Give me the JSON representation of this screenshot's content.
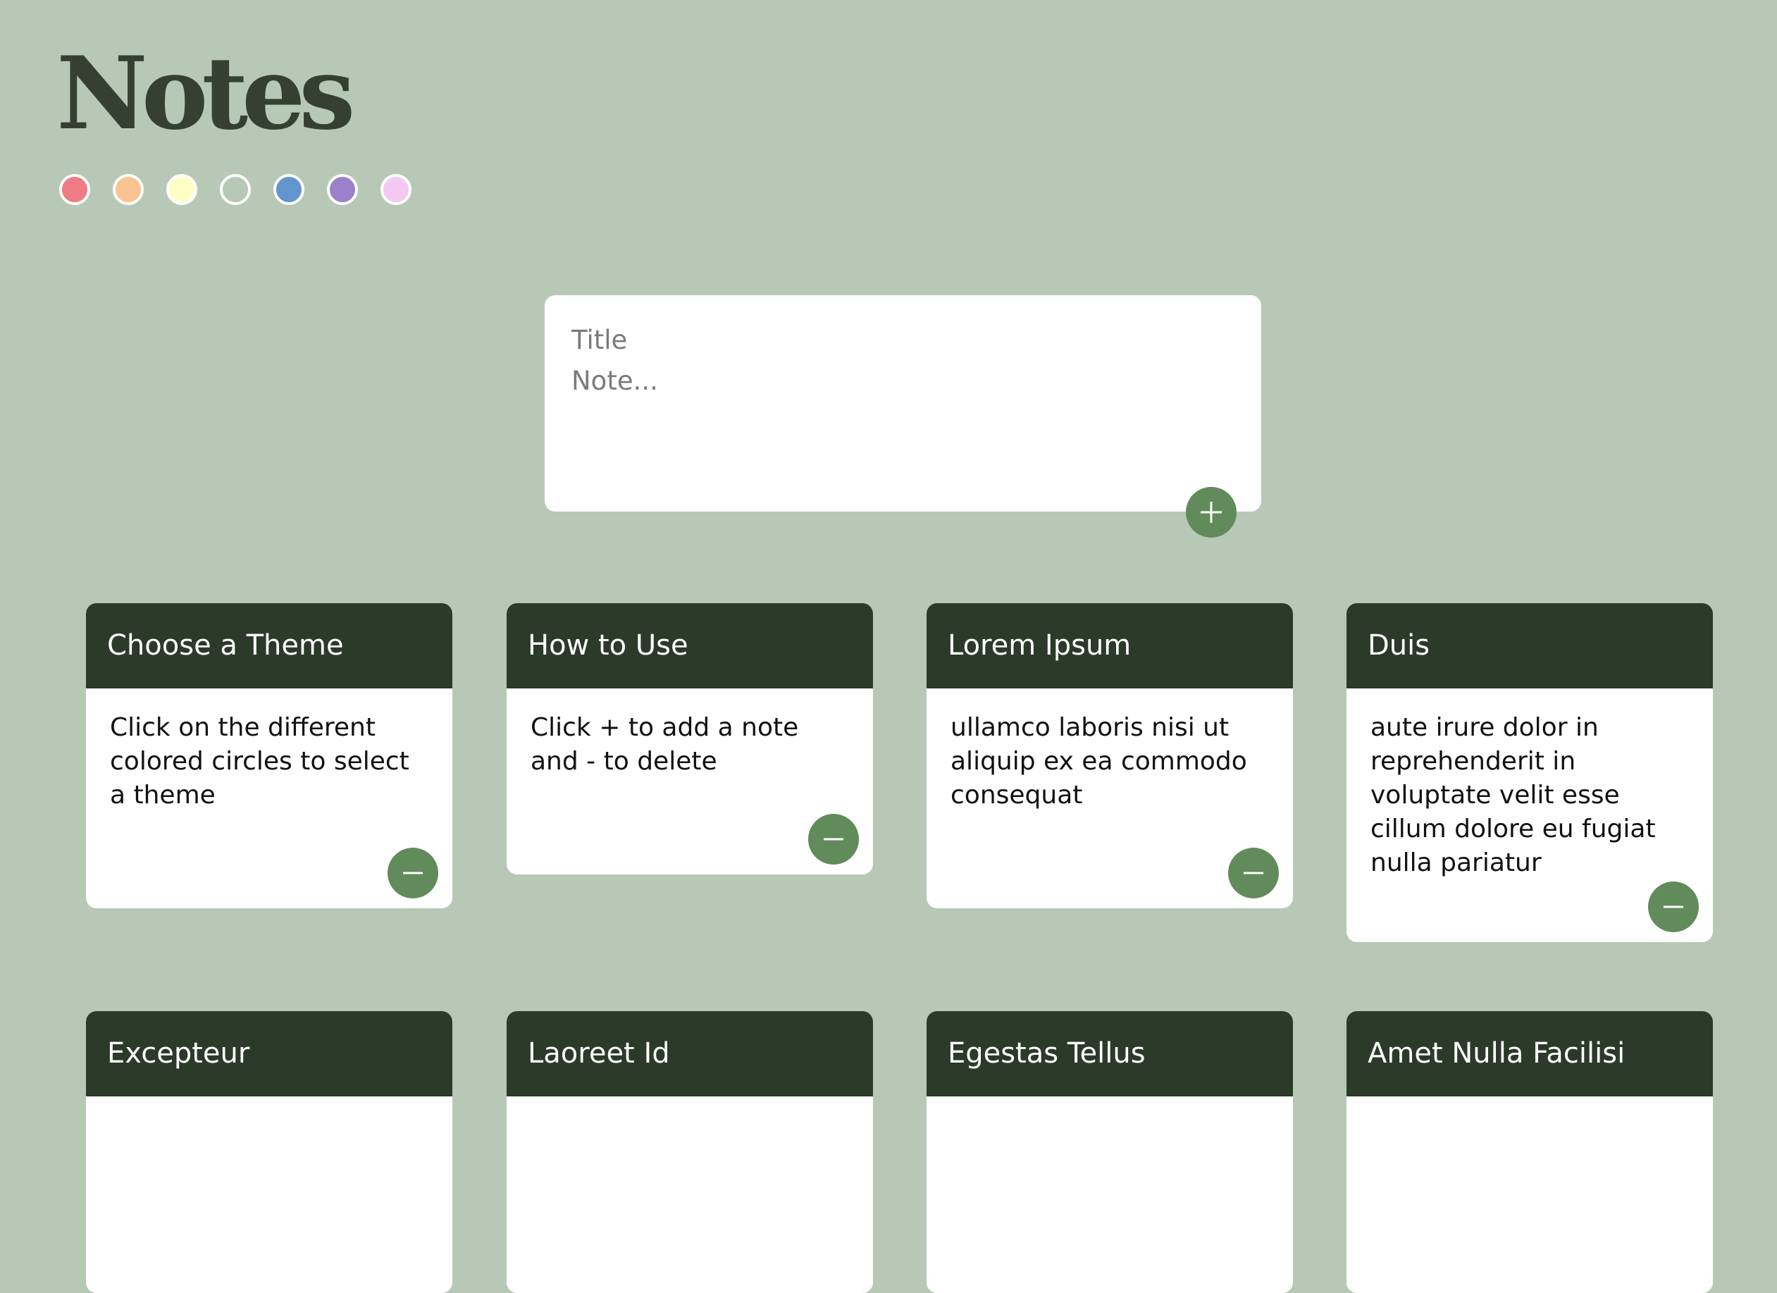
{
  "header": {
    "title": "Notes"
  },
  "themes": [
    {
      "name": "red",
      "color": "#ef7b86"
    },
    {
      "name": "orange",
      "color": "#f9c38f"
    },
    {
      "name": "yellow",
      "color": "#feffc4"
    },
    {
      "name": "sage",
      "color": "#b8c8b6"
    },
    {
      "name": "blue",
      "color": "#6294cd"
    },
    {
      "name": "purple",
      "color": "#9b81c9"
    },
    {
      "name": "pink",
      "color": "#f3c9f2"
    }
  ],
  "composer": {
    "title_placeholder": "Title",
    "note_placeholder": "Note..."
  },
  "notes": [
    {
      "title": "Choose a Theme",
      "body": "Click on the different colored circles to select a theme"
    },
    {
      "title": "How to Use",
      "body": "Click + to add a note and - to delete"
    },
    {
      "title": "Lorem Ipsum",
      "body": "ullamco laboris nisi ut aliquip ex ea commodo consequat"
    },
    {
      "title": "Duis",
      "body": "aute irure dolor in reprehenderit in voluptate velit esse cillum dolore eu fugiat nulla pariatur"
    },
    {
      "title": "Excepteur",
      "body": ""
    },
    {
      "title": "Laoreet Id",
      "body": ""
    },
    {
      "title": "Egestas Tellus",
      "body": ""
    },
    {
      "title": "Amet Nulla Facilisi",
      "body": ""
    }
  ],
  "colors": {
    "background": "#b8c8b6",
    "card_header": "#2b3a29",
    "accent_button": "#618b5a",
    "title_text": "#354032"
  }
}
